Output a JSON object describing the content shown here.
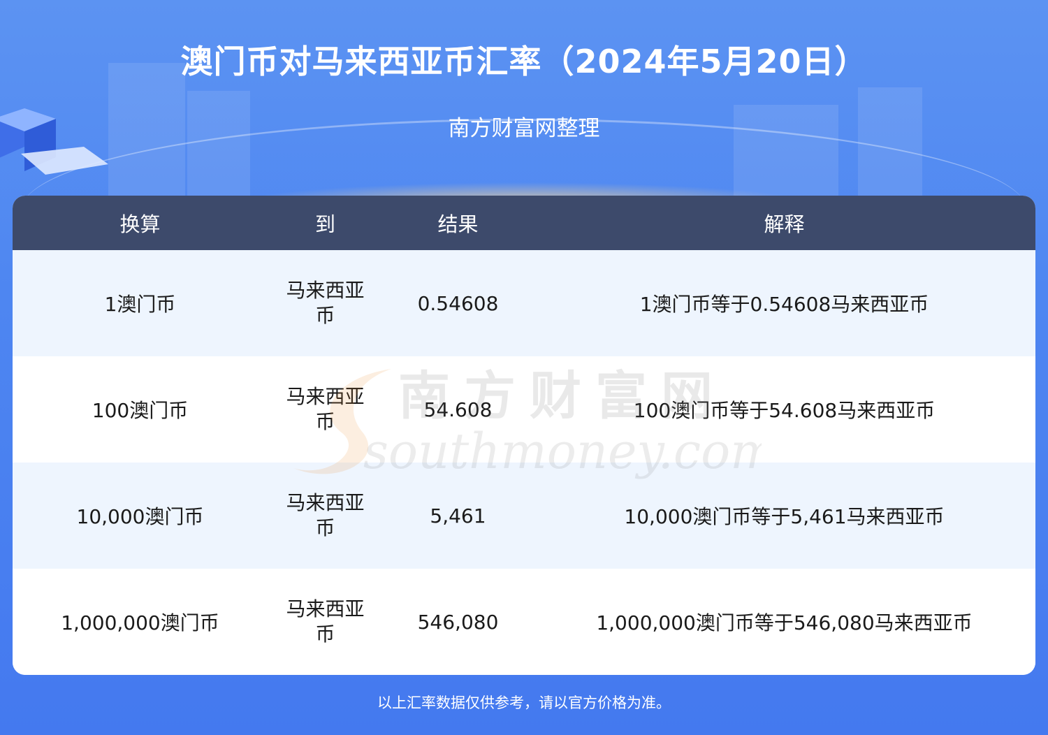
{
  "header": {
    "title": "澳门币对马来西亚币汇率（2024年5月20日）",
    "subtitle": "南方财富网整理"
  },
  "table": {
    "columns": [
      "换算",
      "到",
      "结果",
      "解释"
    ],
    "rows": [
      {
        "from": "1澳门币",
        "to": "马来西亚币",
        "result": "0.54608",
        "explain": "1澳门币等于0.54608马来西亚币"
      },
      {
        "from": "100澳门币",
        "to": "马来西亚币",
        "result": "54.608",
        "explain": "100澳门币等于54.608马来西亚币"
      },
      {
        "from": "10,000澳门币",
        "to": "马来西亚币",
        "result": "5,461",
        "explain": "10,000澳门币等于5,461马来西亚币"
      },
      {
        "from": "1,000,000澳门币",
        "to": "马来西亚币",
        "result": "546,080",
        "explain": "1,000,000澳门币等于546,080马来西亚币"
      }
    ]
  },
  "watermark": {
    "cn": "南方财富网",
    "en": "southmoney.com"
  },
  "footer": {
    "note": "以上汇率数据仅供参考，请以官方价格为准。"
  },
  "colors": {
    "background": "#4e86f1",
    "header_row": "#3d4a6b",
    "row_alt": "#eef5fe"
  }
}
